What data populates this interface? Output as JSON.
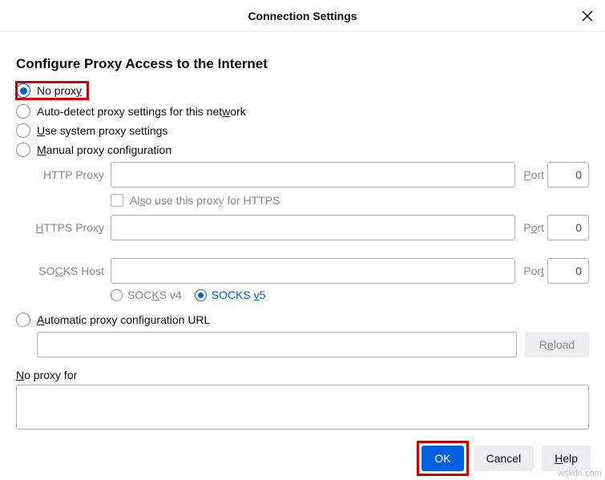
{
  "titlebar": {
    "title": "Connection Settings"
  },
  "heading": "Configure Proxy Access to the Internet",
  "radios": {
    "no_proxy": {
      "label_pre": "No prox",
      "acc": "y",
      "label_post": ""
    },
    "auto_detect": {
      "label_pre": "Auto-detect proxy settings for this net",
      "acc": "w",
      "label_post": "ork"
    },
    "system": {
      "label_pre": "",
      "acc": "U",
      "label_post": "se system proxy settings"
    },
    "manual": {
      "label_pre": "",
      "acc": "M",
      "label_post": "anual proxy configuration"
    },
    "autoconfig": {
      "label_pre": "",
      "acc": "A",
      "label_post": "utomatic proxy configuration URL"
    }
  },
  "fields": {
    "http": {
      "label": "HTTP Proxy",
      "value": "",
      "port_label_pre": "",
      "port_acc": "P",
      "port_label_post": "ort",
      "port": "0"
    },
    "also_https": {
      "label_pre": "Al",
      "acc": "s",
      "label_post": "o use this proxy for HTTPS"
    },
    "https": {
      "label_pre": "",
      "label_acc": "H",
      "label_post": "TTPS Proxy",
      "value": "",
      "port_label_pre": "P",
      "port_acc": "o",
      "port_label_post": "rt",
      "port": "0"
    },
    "socks": {
      "label_pre": "SO",
      "label_acc": "C",
      "label_post": "KS Host",
      "value": "",
      "port_label_pre": "Por",
      "port_acc": "t",
      "port_label_post": "",
      "port": "0"
    },
    "socks_ver": {
      "v4_pre": "SOC",
      "v4_acc": "K",
      "v4_post": "S v4",
      "v5_pre": "SOCKS ",
      "v5_acc": "v",
      "v5_post": "5"
    },
    "pac_value": "",
    "reload": {
      "label_pre": "R",
      "acc": "e",
      "label_post": "load"
    }
  },
  "noproxy": {
    "label_pre": "",
    "acc": "N",
    "label_post": "o proxy for",
    "value": ""
  },
  "buttons": {
    "ok": "OK",
    "cancel": "Cancel",
    "help_pre": "",
    "help_acc": "H",
    "help_post": "elp"
  },
  "watermark": "wsxdn.com"
}
